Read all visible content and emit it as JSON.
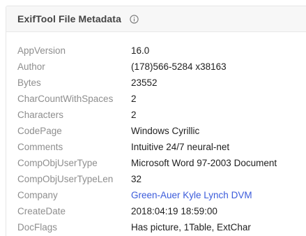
{
  "panel": {
    "title": "ExifTool File Metadata",
    "info_icon": "info-circle-icon"
  },
  "rows": [
    {
      "key": "AppVersion",
      "value": "16.0"
    },
    {
      "key": "Author",
      "value": "(178)566-5284 x38163"
    },
    {
      "key": "Bytes",
      "value": "23552"
    },
    {
      "key": "CharCountWithSpaces",
      "value": "2"
    },
    {
      "key": "Characters",
      "value": "2"
    },
    {
      "key": "CodePage",
      "value": "Windows Cyrillic"
    },
    {
      "key": "Comments",
      "value": "Intuitive 24/7 neural-net"
    },
    {
      "key": "CompObjUserType",
      "value": "Microsoft Word 97-2003 Document"
    },
    {
      "key": "CompObjUserTypeLen",
      "value": "32"
    },
    {
      "key": "Company",
      "value": "Green-Auer Kyle Lynch DVM",
      "link": true
    },
    {
      "key": "CreateDate",
      "value": "2018:04:19 18:59:00"
    },
    {
      "key": "DocFlags",
      "value": "Has picture, 1Table, ExtChar"
    }
  ],
  "colors": {
    "link": "#3b5bdb",
    "key": "#8e8e8e",
    "header_bg": "#f7f7f7"
  }
}
